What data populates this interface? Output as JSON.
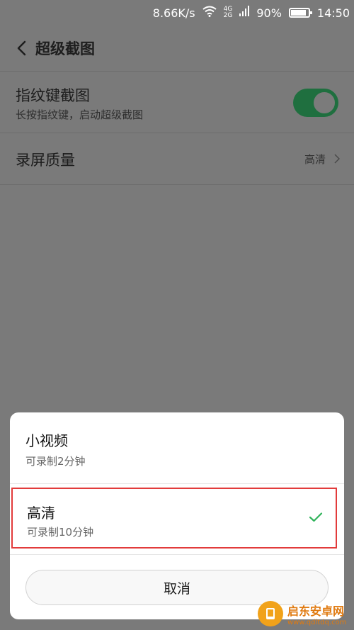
{
  "status_bar": {
    "speed": "8.66K/s",
    "network_top": "4G",
    "network_bottom": "2G",
    "battery": "90%",
    "battery_level": 0.9,
    "time": "14:50",
    "icons": [
      "wifi-icon",
      "signal-icon",
      "battery-icon"
    ]
  },
  "header": {
    "title": "超级截图",
    "back_icon": "chevron-left-icon"
  },
  "settings": {
    "fingerprint": {
      "label": "指纹键截图",
      "description": "长按指纹键，启动超级截图",
      "enabled": true
    },
    "quality": {
      "label": "录屏质量",
      "value": "高清"
    }
  },
  "sheet": {
    "options": [
      {
        "title": "小视频",
        "subtitle": "可录制2分钟",
        "selected": false
      },
      {
        "title": "高清",
        "subtitle": "可录制10分钟",
        "selected": true
      }
    ],
    "cancel_label": "取消"
  },
  "watermark": {
    "name": "启东安卓网",
    "url": "www.qdltdq.com"
  },
  "colors": {
    "toggle_on": "#1f6f3f",
    "check": "#2fb35a",
    "highlight_border": "#e23b3b"
  }
}
